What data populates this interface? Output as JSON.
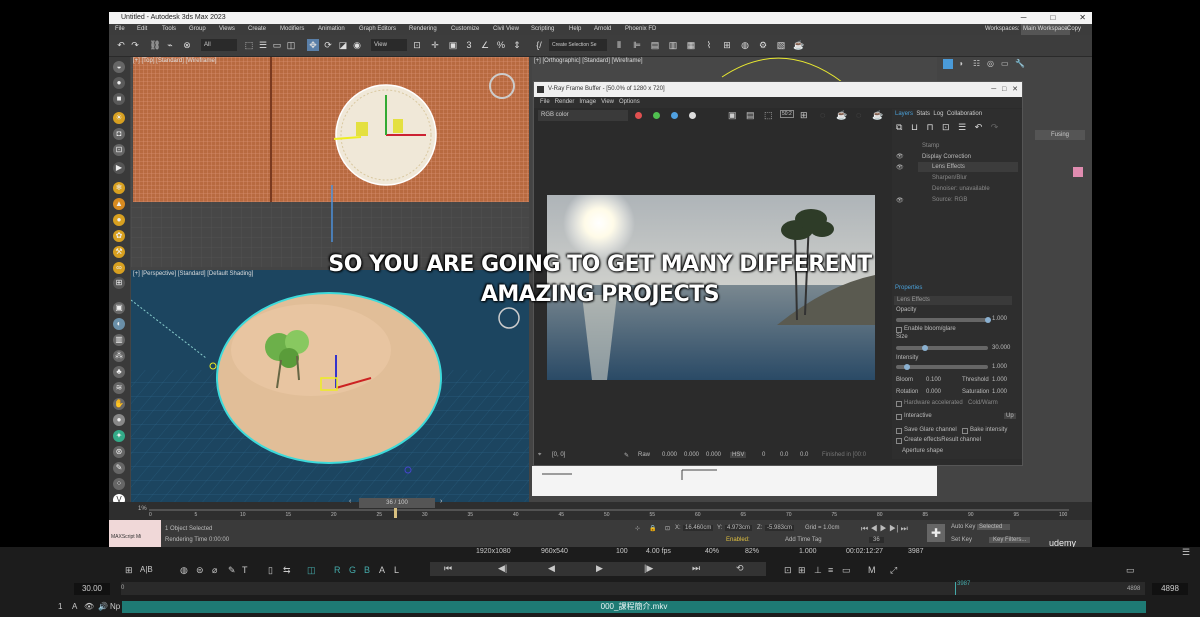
{
  "app": {
    "title": "Untitled - Autodesk 3ds Max 2023",
    "workspace_label": "Workspaces:",
    "workspace_value": "Main Workspace",
    "copy": "Copy"
  },
  "menu": [
    "File",
    "Edit",
    "Tools",
    "Group",
    "Views",
    "Create",
    "Modifiers",
    "Animation",
    "Graph Editors",
    "Rendering",
    "Customize",
    "Civil View",
    "Scripting",
    "Help",
    "Arnold",
    "Phoenix FD"
  ],
  "toolbar": {
    "filter": "All",
    "view": "View",
    "selection_set": "Create Selection Se"
  },
  "viewports": {
    "top_left": "[+] [Top] [Standard] [Wireframe]",
    "top_right": "[+] [Orthographic] [Standard] [Wireframe]",
    "bottom_left": "[+] [Perspective] [Standard] [Default Shading]"
  },
  "vfb": {
    "title": "V-Ray Frame Buffer - [50.0% of 1280 x 720]",
    "menu": [
      "File",
      "Render",
      "Image",
      "View",
      "Options"
    ],
    "channel": "RGB color",
    "zoom_btn": "50:2",
    "tabs": [
      "Layers",
      "Stats",
      "Log",
      "Collaboration"
    ],
    "layers": [
      "Stamp",
      "Display Correction",
      "Lens Effects",
      "Sharpen/Blur",
      "Denoiser: unavailable",
      "Source: RGB"
    ],
    "properties_title": "Properties",
    "prop_header": "Lens Effects",
    "opacity_label": "Opacity",
    "opacity": "1.000",
    "enable_bloom": "Enable bloom/glare",
    "size_label": "Size",
    "size": "30.000",
    "intensity_label": "Intensity",
    "intensity": "1.000",
    "bloom_label": "Bloom",
    "bloom": "0.100",
    "threshold_label": "Threshold",
    "threshold": "1.000",
    "rotation_label": "Rotation",
    "rotation": "0.000",
    "saturation_label": "Saturation",
    "saturation": "1.000",
    "hw_accel": "Hardware accelerated",
    "cold_warm": "Cold/Warm",
    "interactive": "Interactive",
    "up_btn": "Up",
    "save_glare": "Save Glare channel",
    "bake_intensity": "Bake intensity",
    "create_effects": "Create effectsResult channel",
    "aperture": "Aperture shape",
    "coords": "[0, 0]",
    "raw": "Raw",
    "vals": [
      "0.000",
      "0.000",
      "0.000"
    ],
    "hsv": "HSV",
    "hsv_vals": [
      "0",
      "0.0",
      "0.0"
    ],
    "finished": "Finished in [00:0"
  },
  "cmdpanel": {
    "field": "Fusing"
  },
  "timeline": {
    "frame": "36 / 100",
    "ticks": [
      "0",
      "5",
      "10",
      "15",
      "20",
      "25",
      "30",
      "35",
      "40",
      "45",
      "50",
      "55",
      "60",
      "65",
      "70",
      "75",
      "80",
      "85",
      "90",
      "95",
      "100"
    ]
  },
  "status": {
    "selected": "1 Object Selected",
    "render_time": "Rendering Time 0:00:00",
    "maxscript": "MAXScript Mi",
    "x": "16.460cm",
    "y": "4.973cm",
    "z": "-5.983cm",
    "grid": "Grid = 1.0cm",
    "enabled": "Enabled:",
    "add_time_tag": "Add Time Tag",
    "frame_field": "36",
    "auto_key": "Auto Key",
    "selected_dd": "Selected",
    "set_key": "Set Key",
    "key_filters": "Key Filters...",
    "udemy": "udemy"
  },
  "player": {
    "resolution": "1920x1080",
    "viewport": "960x540",
    "zoom_step": "100",
    "fps": "4.00 fps",
    "zoom": "40%",
    "percent": "82%",
    "speed": "1.000",
    "timecode": "00:02:12:27",
    "frame": "3987",
    "left_num": "30.00",
    "right_num": "4898",
    "mid_marker": "3987",
    "right_marker": "4898",
    "start": "0",
    "channel_labels": [
      "R",
      "G",
      "B",
      "A",
      "L"
    ],
    "ab": "A|B",
    "filename": "000_課程簡介.mkv",
    "track_num": "1",
    "track_A": "A",
    "np": "Np"
  },
  "subtitle": {
    "line1": "SO YOU ARE GOING TO GET MANY DIFFERENT",
    "line2": "AMAZING PROJECTS"
  },
  "colors": {
    "wire": "#c8774a",
    "ocean": "#1c4560",
    "island": "#e0bd99",
    "selection": "#3ddada",
    "accent": "#4aa0d8",
    "track": "#1e7a74"
  }
}
